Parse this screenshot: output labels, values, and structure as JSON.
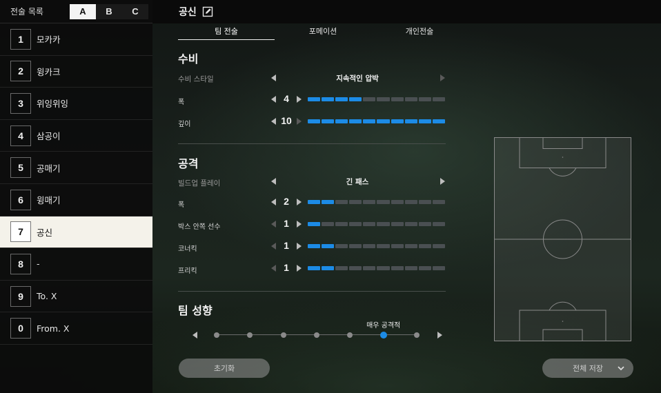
{
  "sidebar": {
    "title": "전술 목록",
    "tabs": [
      {
        "label": "A",
        "active": true
      },
      {
        "label": "B",
        "active": false
      },
      {
        "label": "C",
        "active": false
      }
    ],
    "items": [
      {
        "num": "1",
        "name": "모카카"
      },
      {
        "num": "2",
        "name": "윙카크"
      },
      {
        "num": "3",
        "name": "위잉위잉"
      },
      {
        "num": "4",
        "name": "삼공이"
      },
      {
        "num": "5",
        "name": "공매기"
      },
      {
        "num": "6",
        "name": "윙매기"
      },
      {
        "num": "7",
        "name": "공신",
        "active": true
      },
      {
        "num": "8",
        "name": "-"
      },
      {
        "num": "9",
        "name": "To. X"
      },
      {
        "num": "0",
        "name": "From. X"
      }
    ]
  },
  "header": {
    "title": "공신"
  },
  "tabs": [
    {
      "label": "팀 전술",
      "active": true
    },
    {
      "label": "포메이션",
      "active": false
    },
    {
      "label": "개인전술",
      "active": false
    }
  ],
  "defense": {
    "title": "수비",
    "style_label": "수비 스타일",
    "style_value": "지속적인 압박",
    "width_label": "폭",
    "width_value": "4",
    "width_fraction": 0.4,
    "depth_label": "깊이",
    "depth_value": "10",
    "depth_fraction": 1.0
  },
  "attack": {
    "title": "공격",
    "buildup_label": "빌드업 플레이",
    "buildup_value": "긴 패스",
    "width_label": "폭",
    "width_value": "2",
    "width_fraction": 0.2,
    "box_label": "박스 안쪽 선수",
    "box_value": "1",
    "box_fraction": 0.1,
    "corner_label": "코너킥",
    "corner_value": "1",
    "corner_fraction": 0.2,
    "freekick_label": "프리킥",
    "freekick_value": "1",
    "freekick_fraction": 0.2
  },
  "tendency": {
    "title": "팀 성향",
    "value_label": "매우 공격적",
    "level": 6,
    "levels": 7
  },
  "buttons": {
    "reset_label": "초기화",
    "save_all_label": "전체 저장"
  },
  "colors": {
    "accent": "#1c8be6",
    "active_item_bg": "#f4f2ea"
  }
}
